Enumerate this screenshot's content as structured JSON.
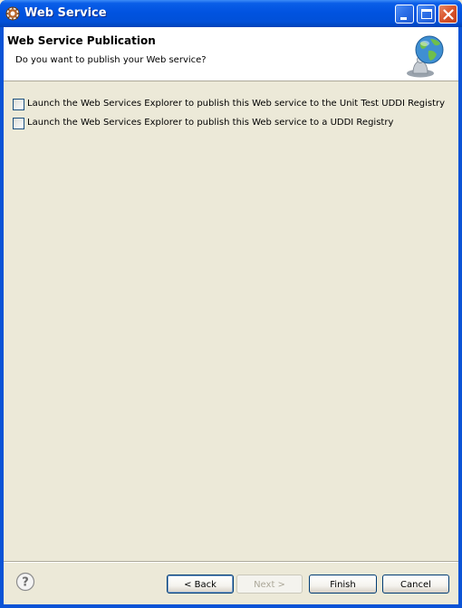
{
  "window": {
    "title": "Web Service"
  },
  "header": {
    "title": "Web Service Publication",
    "description": "Do you want to publish your Web service?"
  },
  "options": [
    {
      "label": "Launch the Web Services Explorer to publish this Web service to the Unit Test UDDI Registry",
      "checked": false
    },
    {
      "label": "Launch the Web Services Explorer to publish this Web service to a UDDI Registry",
      "checked": false
    }
  ],
  "buttons": {
    "back": "< Back",
    "next": "Next >",
    "finish": "Finish",
    "cancel": "Cancel"
  },
  "icons": {
    "app": "eclipse-gear-icon",
    "banner": "globe-web-service-icon",
    "help": "help-icon"
  },
  "colors": {
    "titlebar": "#0153e0",
    "dialog_bg": "#ece9d8",
    "header_bg": "#ffffff",
    "close_button": "#d9542a"
  }
}
